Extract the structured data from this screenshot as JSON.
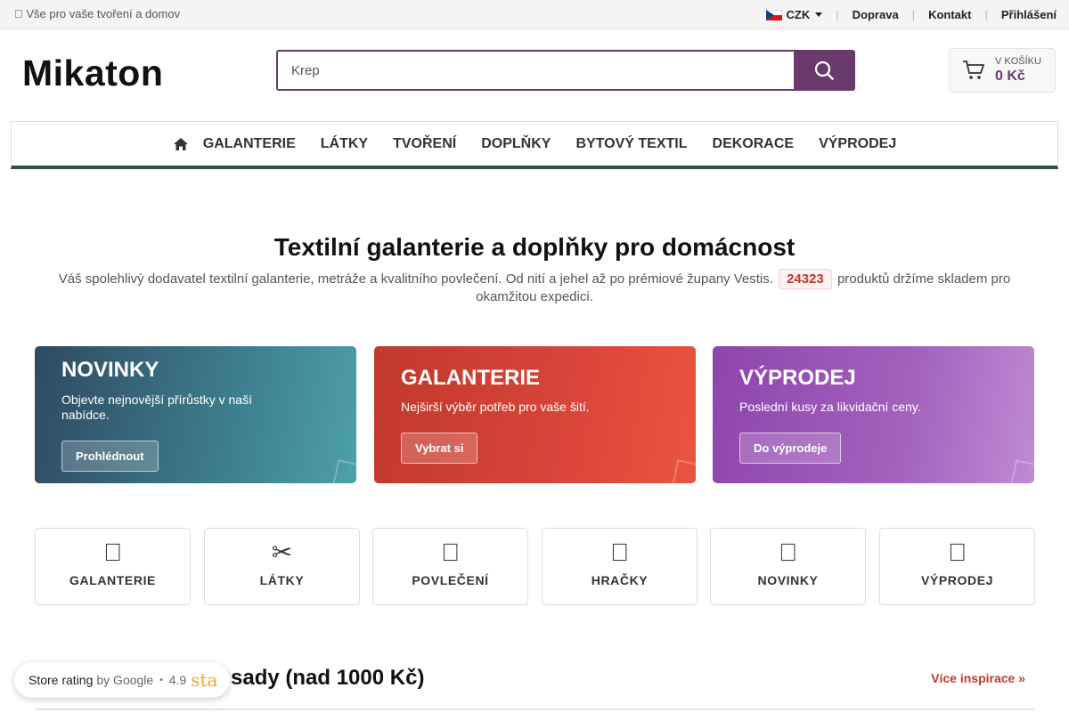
{
  "topbar": {
    "tagline": " Vše pro vaše tvoření a domov",
    "currency": "CZK",
    "links": [
      "Doprava",
      "Kontakt",
      "Přihlášení"
    ]
  },
  "header": {
    "logo": "Mikaton",
    "search_value": "Krep",
    "cart_label": "V KOŠÍKU",
    "cart_total": "0 Kč"
  },
  "nav": {
    "items": [
      "GALANTERIE",
      "LÁTKY",
      "TVOŘENÍ",
      "DOPLŇKY",
      "BYTOVÝ TEXTIL",
      "DEKORACE",
      "VÝPRODEJ"
    ]
  },
  "hero": {
    "title": "Textilní galanterie a doplňky pro domácnost",
    "text_before": "Váš spolehlivý dodavatel textilní galanterie, metráže a kvalitního povlečení. Od nití a jehel až po prémiové župany Vestis.",
    "product_count": "24323",
    "text_after": "produktů držíme skladem pro okamžitou expedici."
  },
  "promos": [
    {
      "title": "NOVINKY",
      "desc": "Objevte nejnovější přírůstky v naší nabídce.",
      "button": "Prohlédnout"
    },
    {
      "title": "GALANTERIE",
      "desc": "Nejširší výběr potřeb pro vaše šití.",
      "button": "Vybrat si"
    },
    {
      "title": "VÝPRODEJ",
      "desc": "Poslední kusy za likvidační ceny.",
      "button": "Do výprodeje"
    }
  ],
  "categories": [
    {
      "icon": "",
      "label": "GALANTERIE"
    },
    {
      "icon": "✂",
      "label": "LÁTKY"
    },
    {
      "icon": "",
      "label": "POVLEČENÍ"
    },
    {
      "icon": "",
      "label": "HRAČKY"
    },
    {
      "icon": "",
      "label": "NOVINKY"
    },
    {
      "icon": "",
      "label": "VÝPRODEJ"
    }
  ],
  "section": {
    "title": "sady (nad 1000 Kč)",
    "more_link": "Více inspirace »"
  },
  "rating": {
    "label": "Store rating",
    "by": "by Google",
    "score": "4.9",
    "stars_text": "sta"
  },
  "colors": {
    "brand": "#6b3a6c",
    "nav_underline": "#2e5149",
    "accent_red": "#c0392b"
  }
}
